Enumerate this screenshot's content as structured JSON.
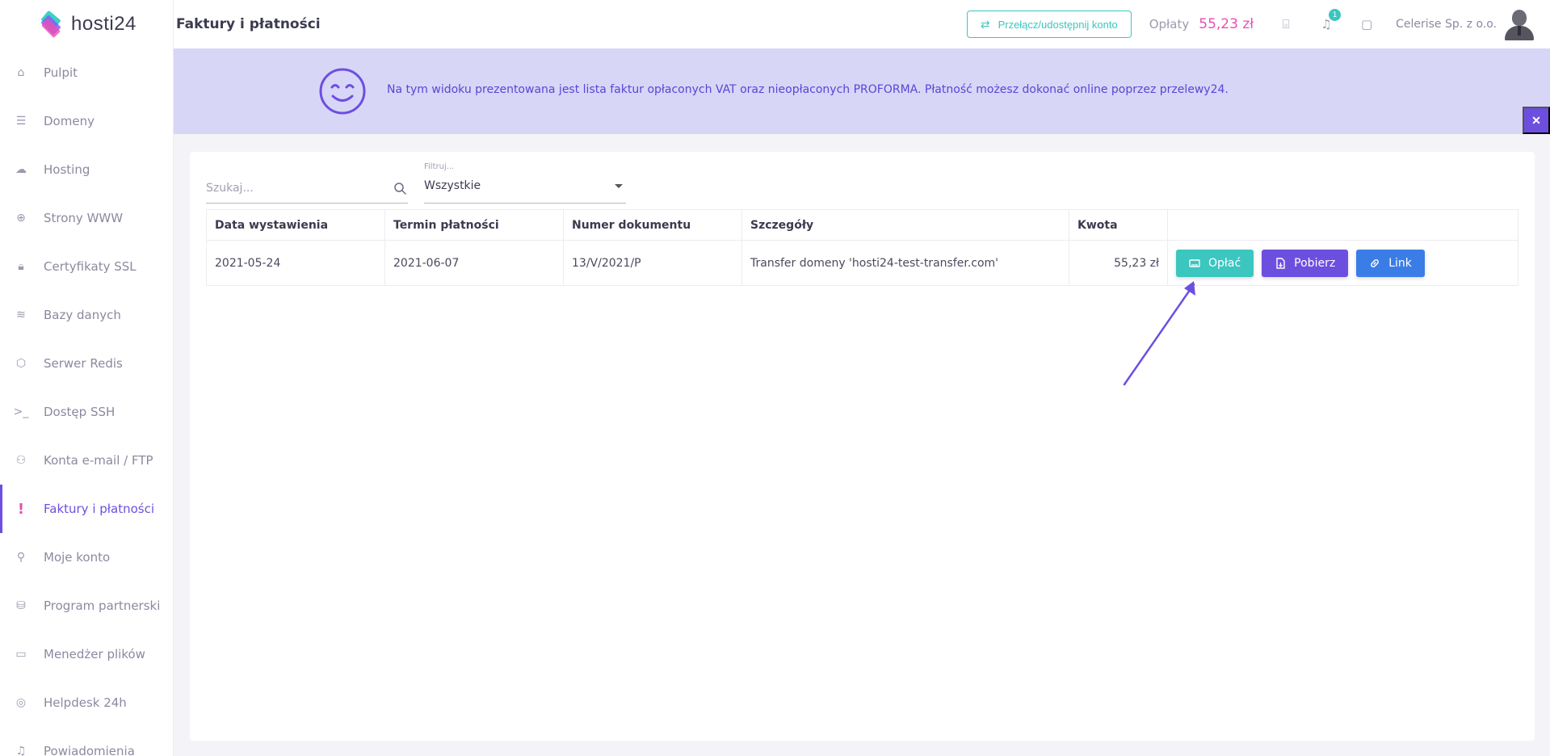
{
  "app": {
    "logo_text": "hosti24"
  },
  "sidebar": {
    "items": [
      {
        "label": "Pulpit",
        "icon": "home-icon",
        "glyph": "⌂"
      },
      {
        "label": "Domeny",
        "icon": "list-icon",
        "glyph": "☰"
      },
      {
        "label": "Hosting",
        "icon": "cloud-icon",
        "glyph": "☁"
      },
      {
        "label": "Strony WWW",
        "icon": "globe-icon",
        "glyph": "⊕"
      },
      {
        "label": "Certyfikaty SSL",
        "icon": "lock-icon",
        "glyph": "🔒︎"
      },
      {
        "label": "Bazy danych",
        "icon": "database-icon",
        "glyph": "≋"
      },
      {
        "label": "Serwer Redis",
        "icon": "box-icon",
        "glyph": "⬡"
      },
      {
        "label": "Dostęp SSH",
        "icon": "terminal-icon",
        "glyph": ">_"
      },
      {
        "label": "Konta e-mail / FTP",
        "icon": "users-icon",
        "glyph": "⚇"
      },
      {
        "label": "Faktury i płatności",
        "icon": "exclamation-icon",
        "glyph": "!",
        "active": true
      },
      {
        "label": "Moje konto",
        "icon": "user-icon",
        "glyph": "⚲"
      },
      {
        "label": "Program partnerski",
        "icon": "partner-icon",
        "glyph": "⛁"
      },
      {
        "label": "Menedżer plików",
        "icon": "folder-icon",
        "glyph": "▭"
      },
      {
        "label": "Helpdesk 24h",
        "icon": "lifebuoy-icon",
        "glyph": "◎"
      },
      {
        "label": "Powiadomienia",
        "icon": "bell-icon",
        "glyph": "♫"
      }
    ]
  },
  "header": {
    "title": "Faktury i płatności",
    "switch_label": "Przełącz/udostępnij konto",
    "switch_glyph": "⇄",
    "fees_label": "Opłaty",
    "fees_value": "55,23 zł",
    "cart_glyph": "⌺",
    "bell_glyph": "♫",
    "notifications_count": "1",
    "chat_glyph": "▢",
    "company": "Celerise Sp. z o.o."
  },
  "banner": {
    "text": "Na tym widoku prezentowana jest lista faktur opłaconych VAT oraz nieopłaconych PROFORMA. Płatność możesz dokonać online poprzez przelewy24.",
    "close_glyph": "✕"
  },
  "filters": {
    "search_placeholder": "Szukaj...",
    "filter_label": "Filtruj...",
    "filter_value": "Wszystkie"
  },
  "table": {
    "columns": [
      "Data wystawienia",
      "Termin płatności",
      "Numer dokumentu",
      "Szczegóły",
      "Kwota",
      ""
    ],
    "rows": [
      {
        "issue_date": "2021-05-24",
        "due_date": "2021-06-07",
        "doc_number": "13/V/2021/P",
        "details": "Transfer domeny 'hosti24-test-transfer.com'",
        "amount": "55,23 zł",
        "pay_label": "Opłać",
        "download_label": "Pobierz",
        "link_label": "Link"
      }
    ]
  },
  "colors": {
    "accent": "#6d4fe0",
    "teal": "#3bc6c0",
    "pink": "#e84fb3",
    "blue": "#3b7de6",
    "banner_bg": "#d8d6f6"
  }
}
